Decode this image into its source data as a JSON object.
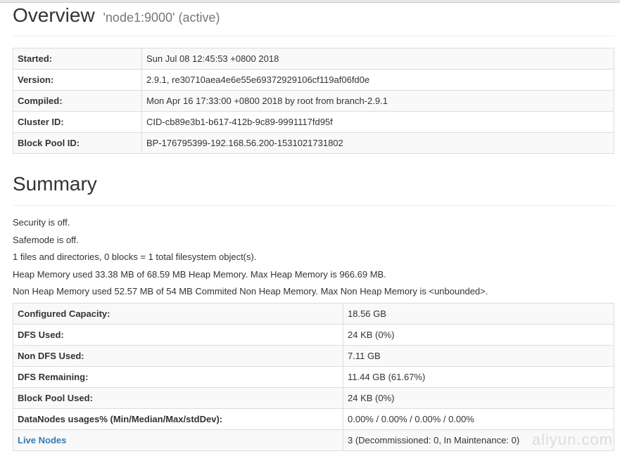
{
  "overview": {
    "title": "Overview",
    "subtitle": "'node1:9000' (active)",
    "rows": [
      {
        "label": "Started:",
        "value": "Sun Jul 08 12:45:53 +0800 2018"
      },
      {
        "label": "Version:",
        "value": "2.9.1, re30710aea4e6e55e69372929106cf119af06fd0e"
      },
      {
        "label": "Compiled:",
        "value": "Mon Apr 16 17:33:00 +0800 2018 by root from branch-2.9.1"
      },
      {
        "label": "Cluster ID:",
        "value": "CID-cb89e3b1-b617-412b-9c89-9991117fd95f"
      },
      {
        "label": "Block Pool ID:",
        "value": "BP-176795399-192.168.56.200-1531021731802"
      }
    ]
  },
  "summary": {
    "title": "Summary",
    "lines": [
      "Security is off.",
      "Safemode is off.",
      "1 files and directories, 0 blocks = 1 total filesystem object(s).",
      "Heap Memory used 33.38 MB of 68.59 MB Heap Memory. Max Heap Memory is 966.69 MB.",
      "Non Heap Memory used 52.57 MB of 54 MB Commited Non Heap Memory. Max Non Heap Memory is <unbounded>."
    ],
    "rows": [
      {
        "label": "Configured Capacity:",
        "value": "18.56 GB"
      },
      {
        "label": "DFS Used:",
        "value": "24 KB (0%)"
      },
      {
        "label": "Non DFS Used:",
        "value": "7.11 GB"
      },
      {
        "label": "DFS Remaining:",
        "value": "11.44 GB (61.67%)"
      },
      {
        "label": "Block Pool Used:",
        "value": "24 KB (0%)"
      },
      {
        "label": "DataNodes usages% (Min/Median/Max/stdDev):",
        "value": "0.00% / 0.00% / 0.00% / 0.00%"
      },
      {
        "label": "Live Nodes",
        "value": "3 (Decommissioned: 0, In Maintenance: 0)"
      }
    ]
  },
  "watermark": "aliyun.com"
}
